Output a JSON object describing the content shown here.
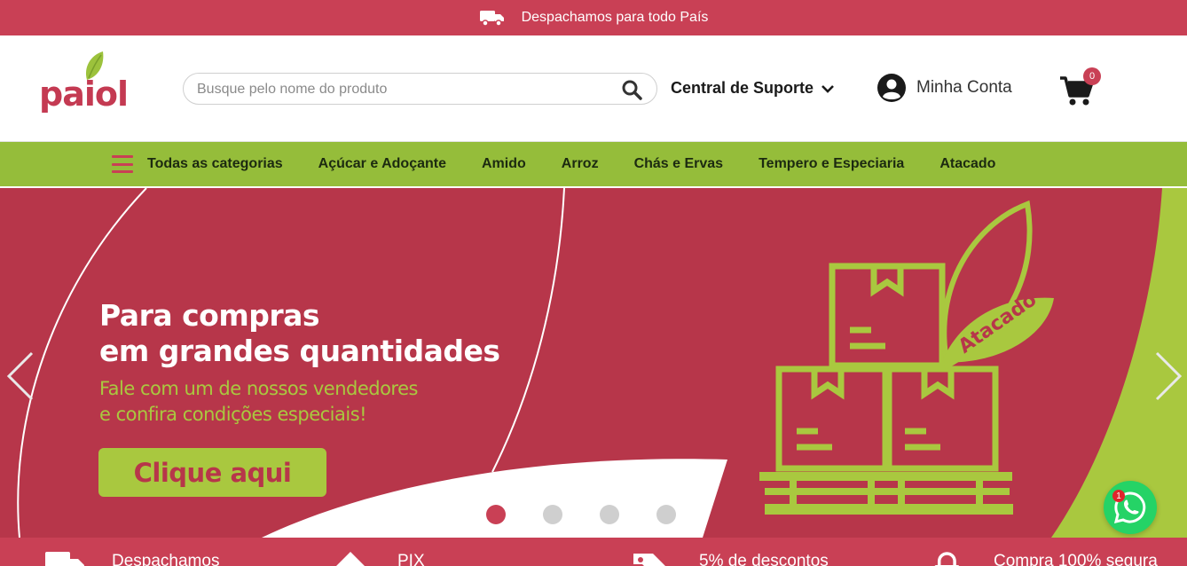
{
  "topbar": {
    "shipping_text": "Despachamos para todo País",
    "icon": "truck-icon"
  },
  "header": {
    "logo_text": "paiol",
    "search": {
      "placeholder": "Busque pelo nome do produto",
      "value": ""
    },
    "support_label": "Central de Suporte",
    "account_label": "Minha Conta",
    "cart_count": "0"
  },
  "nav": {
    "all_categories": "Todas as categorias",
    "categories": [
      "Açúcar e Adoçante",
      "Amido",
      "Arroz",
      "Chás e Ervas",
      "Tempero e Especiaria",
      "Atacado"
    ]
  },
  "hero": {
    "title_line1": "Para compras",
    "title_line2": "em grandes quantidades",
    "subtitle_line1": "Fale com um de nossos vendedores",
    "subtitle_line2": "e confira condições especiais!",
    "button_label": "Clique aqui",
    "tag": "Atacado",
    "slide_count": 4,
    "active_slide": 1
  },
  "benefits": [
    {
      "label": "Despachamos",
      "icon": "truck-icon"
    },
    {
      "label": "PIX",
      "icon": "pix-icon"
    },
    {
      "label": "5% de descontos",
      "icon": "tag-icon"
    },
    {
      "label": "Compra 100% segura",
      "icon": "lock-icon"
    }
  ],
  "whatsapp": {
    "badge": "1"
  },
  "colors": {
    "brand_red": "#c94055",
    "brand_green": "#95bd3a",
    "banner_red": "#b7364a",
    "banner_green": "#a9c83f"
  }
}
